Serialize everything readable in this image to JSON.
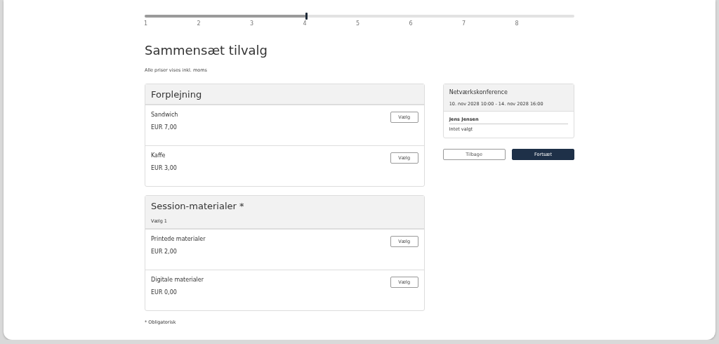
{
  "progress": {
    "level": 0.375,
    "steps": [
      "1",
      "2",
      "3",
      "4",
      "5",
      "6",
      "7",
      "8"
    ]
  },
  "title": "Sammensæt tilvalg",
  "note": "Alle priser vises inkl. moms",
  "groups": [
    {
      "title": "Forplejning",
      "items": [
        {
          "name": "Sandwich",
          "price": "EUR 7,00",
          "button": "Vælg"
        },
        {
          "name": "Kaffe",
          "price": "EUR 3,00",
          "button": "Vælg"
        }
      ]
    },
    {
      "title": "Session-materialer *",
      "subtitle": "Vælg 1",
      "items": [
        {
          "name": "Printede materialer",
          "price": "EUR 2,00",
          "button": "Vælg"
        },
        {
          "name": "Digitale materialer",
          "price": "EUR 0,00",
          "button": "Vælg"
        }
      ]
    }
  ],
  "footnote": "* Obligatorisk",
  "summary": {
    "event": "Netværkskonference",
    "dates": "10. nov 2028 10:00 - 14. nov 2028 16:00",
    "person": "Jens Jensen",
    "selection": "Intet valgt"
  },
  "buttons": [
    {
      "label": "Tilbage",
      "kind": "secondary"
    },
    {
      "label": "Fortsæt",
      "kind": "primary"
    }
  ]
}
